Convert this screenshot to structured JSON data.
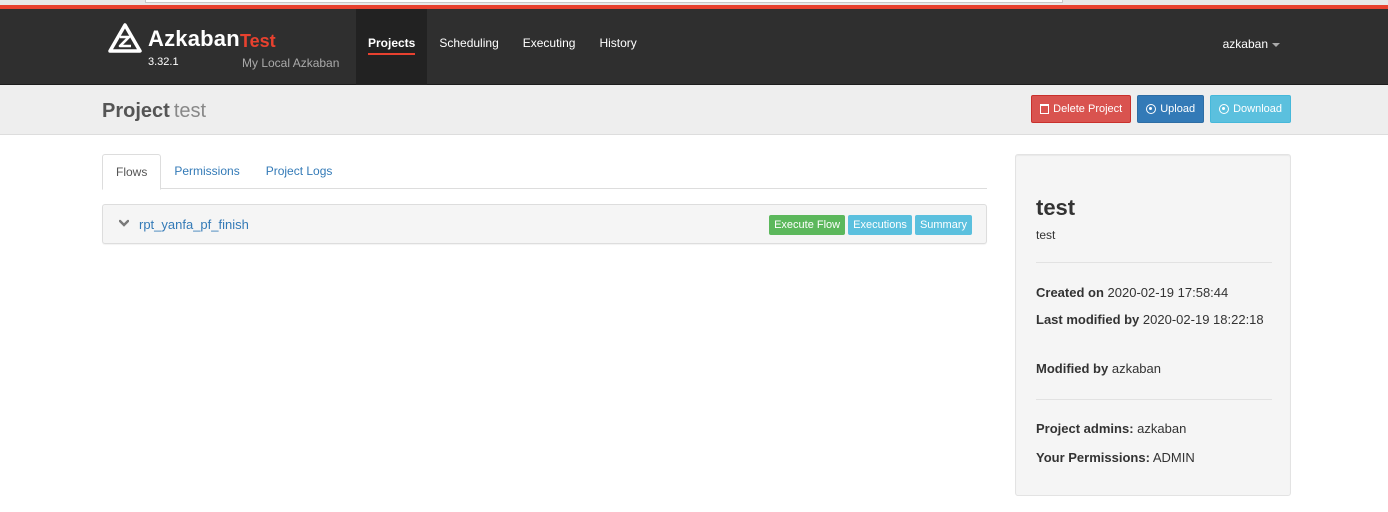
{
  "brand": {
    "name": "Azkaban",
    "env": "Test",
    "version": "3.32.1",
    "description": "My Local Azkaban"
  },
  "nav": {
    "items": [
      {
        "label": "Projects",
        "active": true
      },
      {
        "label": "Scheduling"
      },
      {
        "label": "Executing"
      },
      {
        "label": "History"
      }
    ],
    "user": "azkaban"
  },
  "header": {
    "title": "Project",
    "subtitle": "test",
    "delete_label": "Delete Project",
    "upload_label": "Upload",
    "download_label": "Download"
  },
  "tabs": [
    {
      "label": "Flows",
      "active": true
    },
    {
      "label": "Permissions"
    },
    {
      "label": "Project Logs"
    }
  ],
  "flows": [
    {
      "name": "rpt_yanfa_pf_finish",
      "execute_label": "Execute Flow",
      "executions_label": "Executions",
      "summary_label": "Summary"
    }
  ],
  "project_info": {
    "name": "test",
    "description": "test",
    "created_on_label": "Created on",
    "created_on": "2020-02-19 17:58:44",
    "last_modified_label": "Last modified by",
    "last_modified": "2020-02-19 18:22:18",
    "modified_by_label": "Modified by",
    "modified_by": "azkaban",
    "admins_label": "Project admins:",
    "admins": "azkaban",
    "permissions_label": "Your Permissions:",
    "permissions": "ADMIN"
  },
  "colors": {
    "accent": "#e8412f",
    "navbar": "#2f2f2f",
    "link": "#337ab7",
    "success": "#5cb85c",
    "info": "#5bc0de",
    "danger": "#d9534f"
  }
}
